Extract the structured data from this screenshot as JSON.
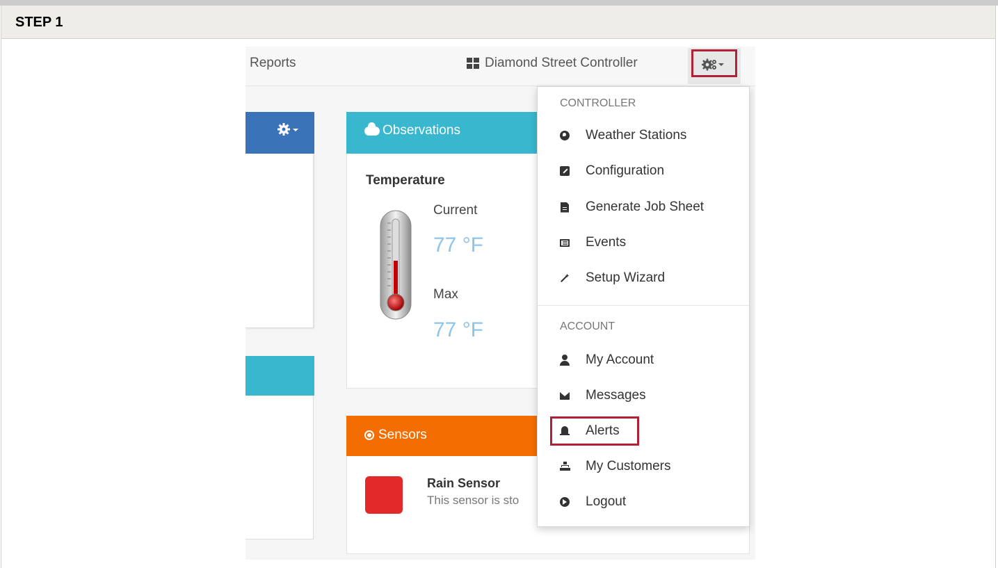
{
  "step": {
    "title": "STEP 1"
  },
  "navbar": {
    "reports_label": "Reports",
    "controller_label": "Diamond Street Controller",
    "gear_menu_icon": "gears-icon"
  },
  "observations": {
    "title": "Observations",
    "temperature_label": "Temperature",
    "current_label": "Current",
    "current_value": "77 °F",
    "max_label": "Max",
    "max_value": "77 °F"
  },
  "sensors": {
    "title": "Sensors",
    "sensor_name": "Rain Sensor",
    "sensor_desc": "This sensor is sto",
    "sensor_status_color": "#e22a2a"
  },
  "menu": {
    "controller_section": "CONTROLLER",
    "controller_items": [
      {
        "label": "Weather Stations",
        "icon": "globe-icon"
      },
      {
        "label": "Configuration",
        "icon": "edit-icon"
      },
      {
        "label": "Generate Job Sheet",
        "icon": "file-icon"
      },
      {
        "label": "Events",
        "icon": "list-icon"
      },
      {
        "label": "Setup Wizard",
        "icon": "magic-wand-icon"
      }
    ],
    "account_section": "ACCOUNT",
    "account_items": [
      {
        "label": "My Account",
        "icon": "user-icon"
      },
      {
        "label": "Messages",
        "icon": "envelope-icon"
      },
      {
        "label": "Alerts",
        "icon": "bell-icon"
      },
      {
        "label": "My Customers",
        "icon": "sitemap-icon"
      },
      {
        "label": "Logout",
        "icon": "logout-icon"
      }
    ]
  },
  "colors": {
    "highlight": "#b22035",
    "panel_blue": "#3b73b9",
    "panel_cyan": "#38b7cf",
    "panel_orange": "#f46d00",
    "temp_value": "#8cc4ea"
  }
}
